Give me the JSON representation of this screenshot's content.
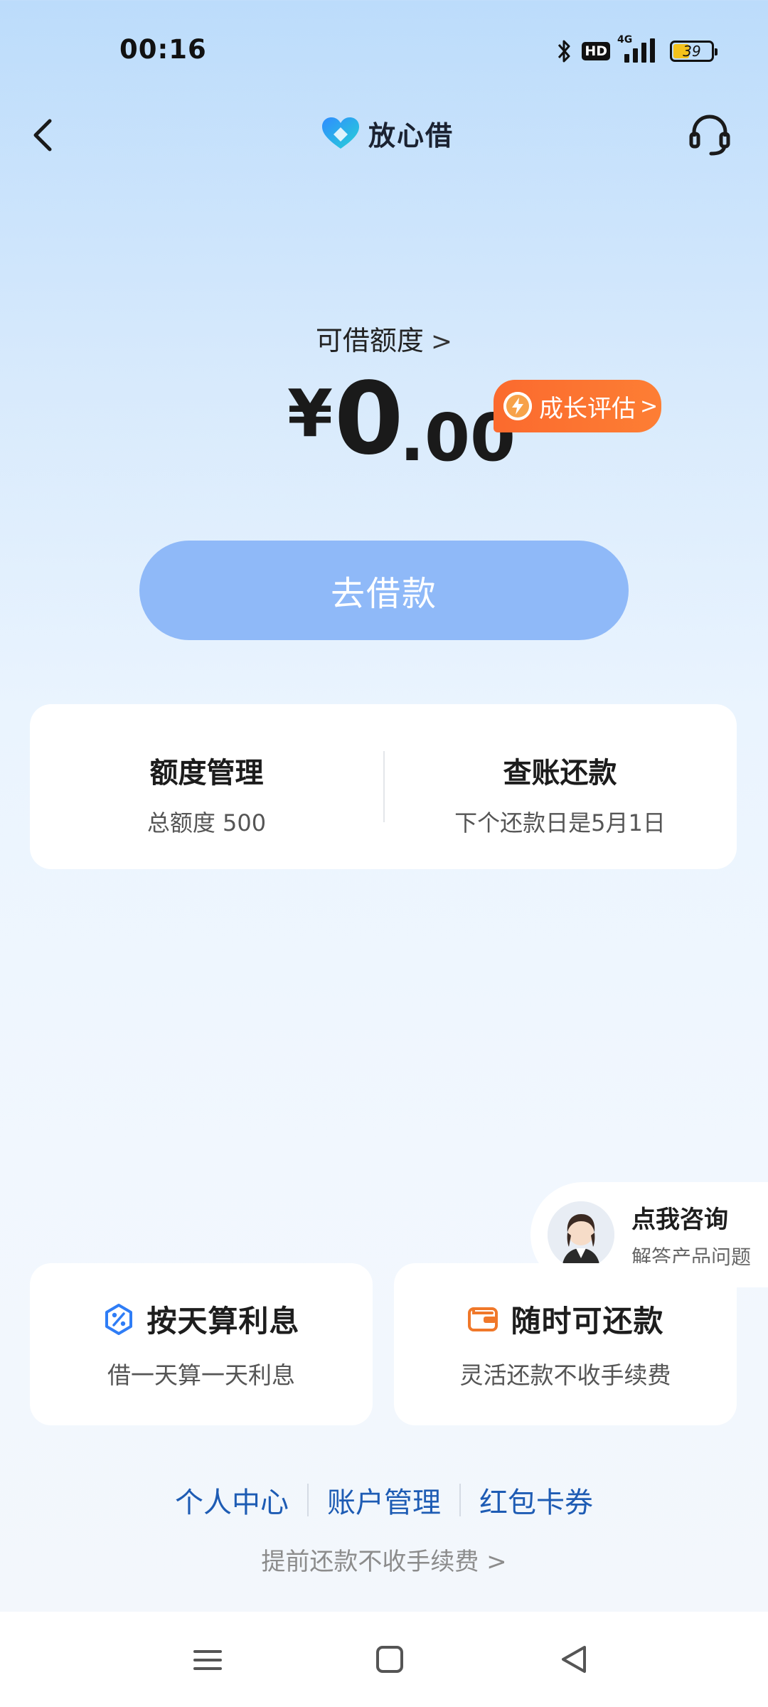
{
  "status_bar": {
    "time": "00:16",
    "hd": "HD",
    "network": "4G",
    "battery": "39"
  },
  "header": {
    "title": "放心借",
    "icons": [
      "back-icon",
      "logo-icon",
      "headset-icon"
    ]
  },
  "amount_section": {
    "label": "可借额度",
    "currency": "¥",
    "amount_int": "0",
    "amount_dec": ".00",
    "growth_button": "成长评估",
    "borrow_button": "去借款"
  },
  "manage_card": {
    "left": {
      "title": "额度管理",
      "subtitle": "总额度 500"
    },
    "right": {
      "title": "查账还款",
      "subtitle": "下个还款日是5月1日"
    }
  },
  "consult": {
    "title": "点我咨询",
    "subtitle": "解答产品问题"
  },
  "features": [
    {
      "title": "按天算利息",
      "subtitle": "借一天算一天利息",
      "icon": "percent-icon",
      "color": "#2f7df6"
    },
    {
      "title": "随时可还款",
      "subtitle": "灵活还款不收手续费",
      "icon": "wallet-icon",
      "color": "#f0782a"
    }
  ],
  "links": [
    "个人中心",
    "账户管理",
    "红包卡券"
  ],
  "prepay_text": "提前还款不收手续费",
  "colors": {
    "primary_button": "#8fb9f8",
    "accent_orange": "#fb6a2e",
    "link_blue": "#1e5cb4"
  }
}
